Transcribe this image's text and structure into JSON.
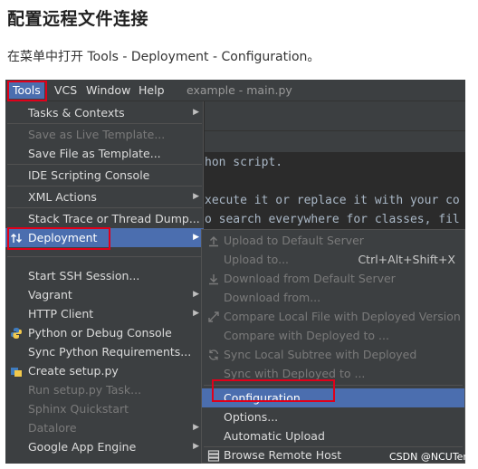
{
  "article": {
    "heading": "配置远程文件连接",
    "intro": "在菜单中打开 Tools - Deployment - Configuration。",
    "watermark": "CSDN @NCUTer"
  },
  "menubar": {
    "items": [
      "Tools",
      "VCS",
      "Window",
      "Help"
    ],
    "window_title": "example - main.py"
  },
  "editor": {
    "lines": [
      "hon script.",
      "xecute it or replace it with your co",
      "o search everywhere for classes, fil"
    ]
  },
  "tools_menu": {
    "items": [
      {
        "label": "Tasks & Contexts",
        "submenu": true,
        "enabled": true
      },
      {
        "label": "Save as Live Template...",
        "enabled": false
      },
      {
        "label": "Save File as Template...",
        "enabled": true
      },
      {
        "label": "IDE Scripting Console",
        "enabled": true
      },
      {
        "label": "XML Actions",
        "submenu": true,
        "enabled": true
      },
      {
        "label": "Stack Trace or Thread Dump...",
        "enabled": true
      },
      {
        "label": "Deployment",
        "submenu": true,
        "enabled": true,
        "selected": true
      },
      {
        "label": "Start SSH Session...",
        "enabled": true
      },
      {
        "label": "Vagrant",
        "submenu": true,
        "enabled": true
      },
      {
        "label": "HTTP Client",
        "submenu": true,
        "enabled": true
      },
      {
        "label": "Python or Debug Console",
        "enabled": true
      },
      {
        "label": "Sync Python Requirements...",
        "enabled": true
      },
      {
        "label": "Create setup.py",
        "enabled": true
      },
      {
        "label": "Run setup.py Task...",
        "enabled": false
      },
      {
        "label": "Sphinx Quickstart",
        "enabled": false
      },
      {
        "label": "Datalore",
        "submenu": true,
        "enabled": false
      },
      {
        "label": "Google App Engine",
        "submenu": true,
        "enabled": true
      }
    ]
  },
  "deployment_menu": {
    "items": [
      {
        "label": "Upload to Default Server",
        "enabled": false
      },
      {
        "label": "Upload to...",
        "shortcut": "Ctrl+Alt+Shift+X",
        "enabled": false
      },
      {
        "label": "Download from Default Server",
        "enabled": false
      },
      {
        "label": "Download from...",
        "enabled": false
      },
      {
        "label": "Compare Local File with Deployed Version",
        "enabled": false
      },
      {
        "label": "Compare with Deployed to ...",
        "enabled": false
      },
      {
        "label": "Sync Local Subtree with Deployed",
        "enabled": false
      },
      {
        "label": "Sync with Deployed to ...",
        "enabled": false
      },
      {
        "label": "Configuration...",
        "enabled": true,
        "selected": true
      },
      {
        "label": "Options...",
        "enabled": true
      },
      {
        "label": "Automatic Upload",
        "enabled": true
      },
      {
        "label": "Browse Remote Host",
        "enabled": true
      }
    ]
  },
  "colors": {
    "menu_bg": "#3c3f41",
    "selection": "#4b6eaf",
    "highlight_box": "#e0001a",
    "editor_bg": "#2b2b2b"
  }
}
